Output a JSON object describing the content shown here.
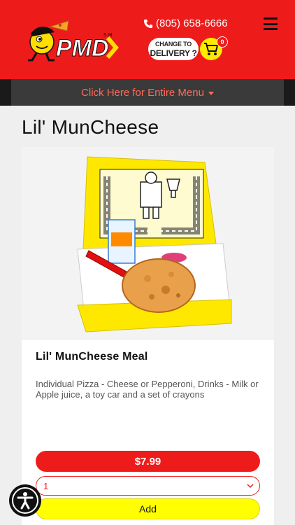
{
  "header": {
    "brand": "PMD",
    "phone": "(805) 658-6666",
    "delivery_line1": "CHANGE TO",
    "delivery_line2": "DELIVERY ?",
    "cart_count": "0",
    "icons": {
      "phone": "phone-icon",
      "cart": "cart-icon",
      "menu": "hamburger-icon"
    }
  },
  "menu_bar": {
    "label": "Click Here for Entire Menu"
  },
  "page": {
    "title": "Lil' MunCheese"
  },
  "product": {
    "name": "Lil' MunCheese Meal",
    "description": "Individual Pizza - Cheese or Pepperoni, Drinks - Milk or Apple juice, a toy car and a set of crayons",
    "price": "$7.99",
    "quantity": "1",
    "add_label": "Add"
  },
  "colors": {
    "brand_red": "#ee1b1b",
    "brand_yellow": "#ffeb00",
    "menu_text": "#ff6a5a"
  }
}
